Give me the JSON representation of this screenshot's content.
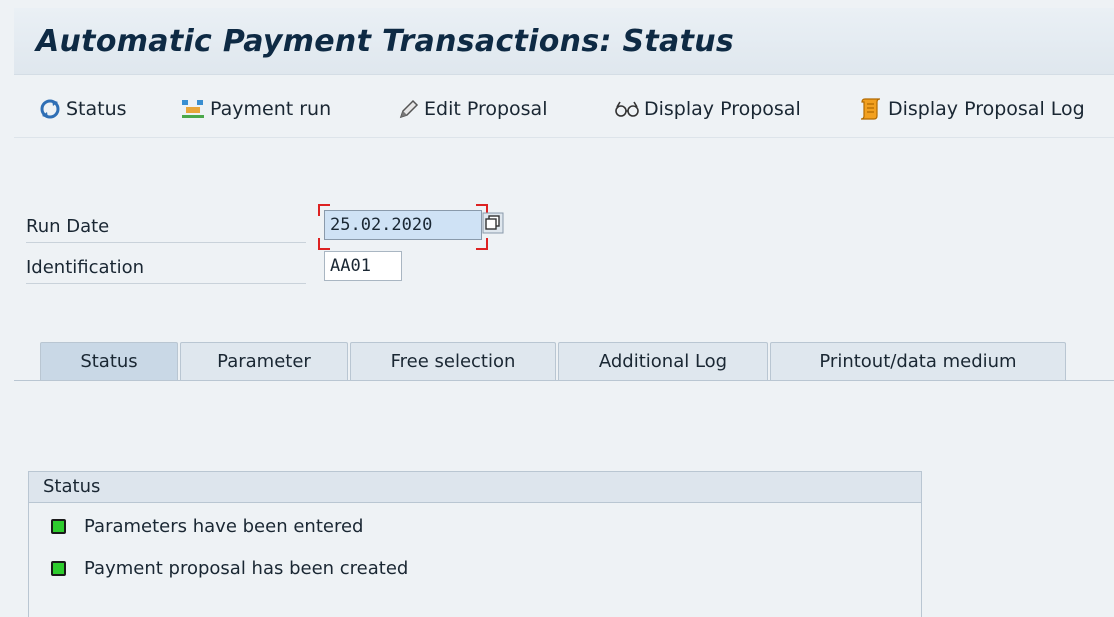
{
  "window": {
    "title": "Automatic Payment Transactions: Status"
  },
  "toolbar": {
    "status": "Status",
    "payment_run": "Payment run",
    "edit_proposal": "Edit Proposal",
    "display_proposal": "Display Proposal",
    "display_proposal_log": "Display Proposal Log"
  },
  "form": {
    "run_date_label": "Run Date",
    "run_date_value": "25.02.2020",
    "identification_label": "Identification",
    "identification_value": "AA01"
  },
  "tabs": [
    {
      "label": "Status",
      "active": true
    },
    {
      "label": "Parameter",
      "active": false
    },
    {
      "label": "Free selection",
      "active": false
    },
    {
      "label": "Additional Log",
      "active": false
    },
    {
      "label": "Printout/data medium",
      "active": false
    }
  ],
  "status_group": {
    "header": "Status",
    "items": [
      {
        "text": "Parameters have been entered",
        "color": "#2ecc2e"
      },
      {
        "text": "Payment proposal has been created",
        "color": "#2ecc2e"
      }
    ]
  },
  "colors": {
    "accent": "#0e2a44",
    "focus": "#dd2222",
    "led_green": "#2ecc2e"
  }
}
